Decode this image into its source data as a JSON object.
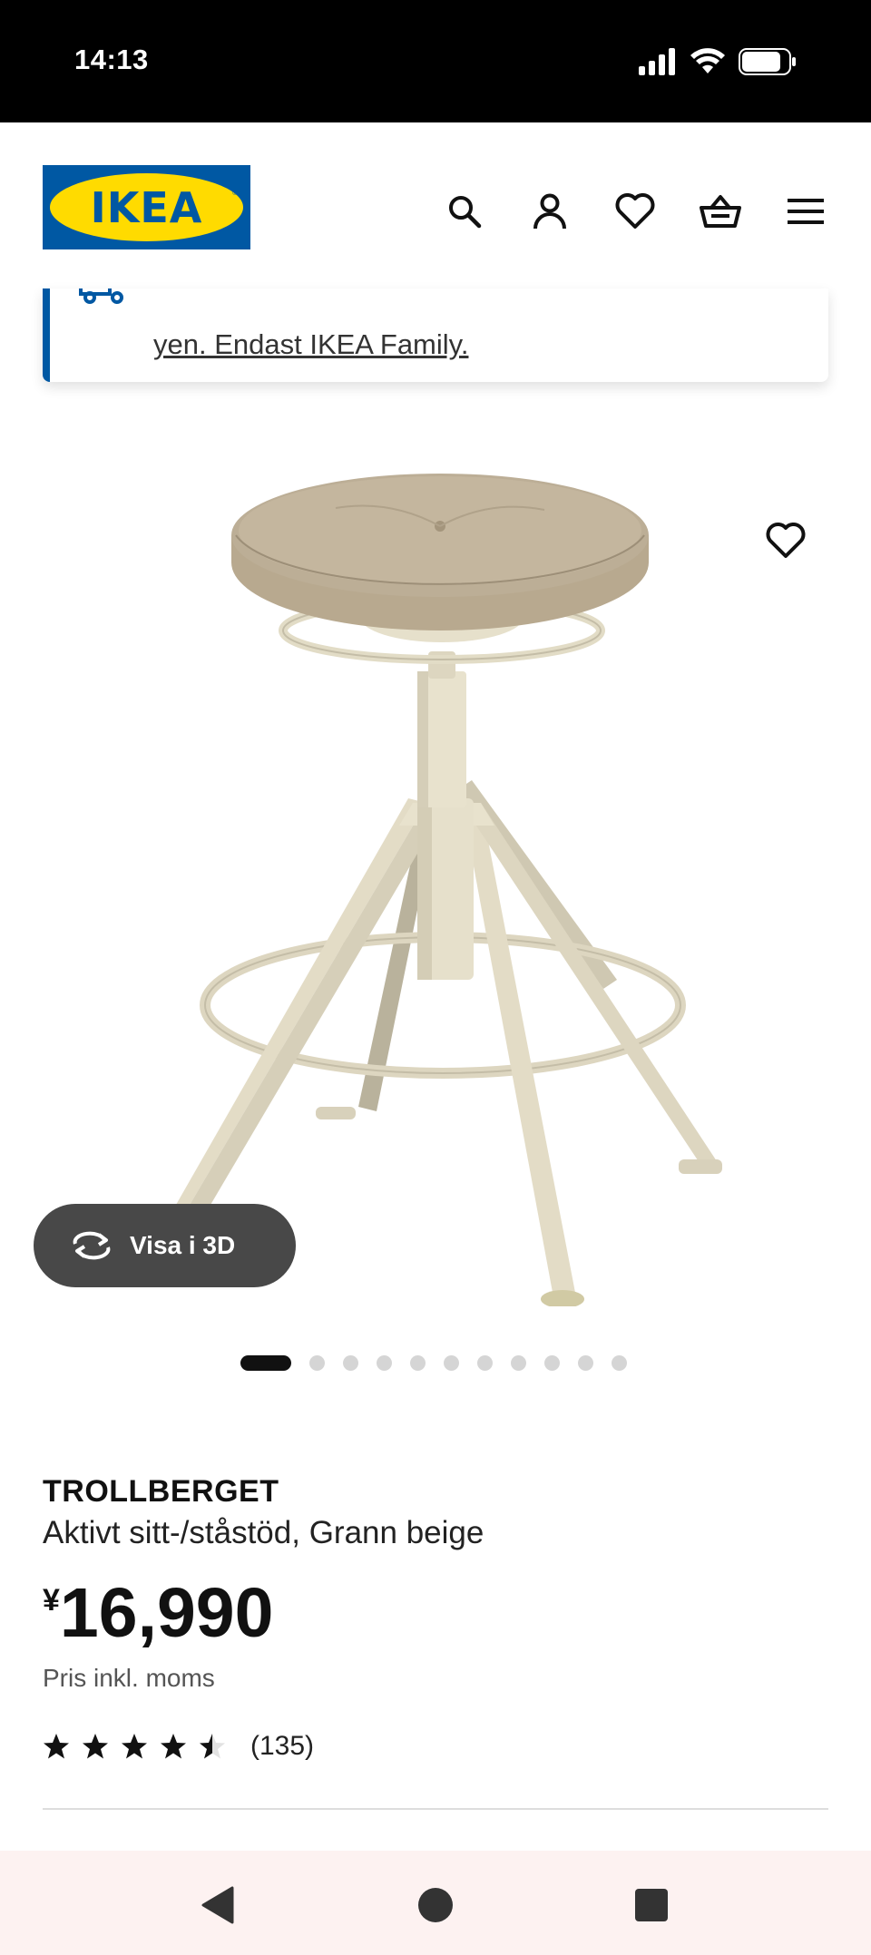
{
  "status_bar": {
    "time": "14:13"
  },
  "header": {
    "logo_text": "IKEA",
    "icons": [
      "search-icon",
      "user-icon",
      "heart-icon",
      "basket-icon",
      "menu-icon"
    ]
  },
  "notice": {
    "line2": "yen. Endast IKEA Family."
  },
  "gallery": {
    "view3d_label": "Visa i 3D",
    "image_count": 11,
    "active_index": 0
  },
  "product": {
    "name": "TROLLBERGET",
    "description": "Aktivt sitt-/ståstöd, Grann beige",
    "currency": "¥",
    "price": "16,990",
    "price_note": "Pris inkl. moms",
    "rating": 4.5,
    "review_count": "(135)"
  },
  "colors": {
    "brand_blue": "#0058a3",
    "brand_yellow": "#ffdb00",
    "nav_bar_bg": "#fdf2f1"
  }
}
